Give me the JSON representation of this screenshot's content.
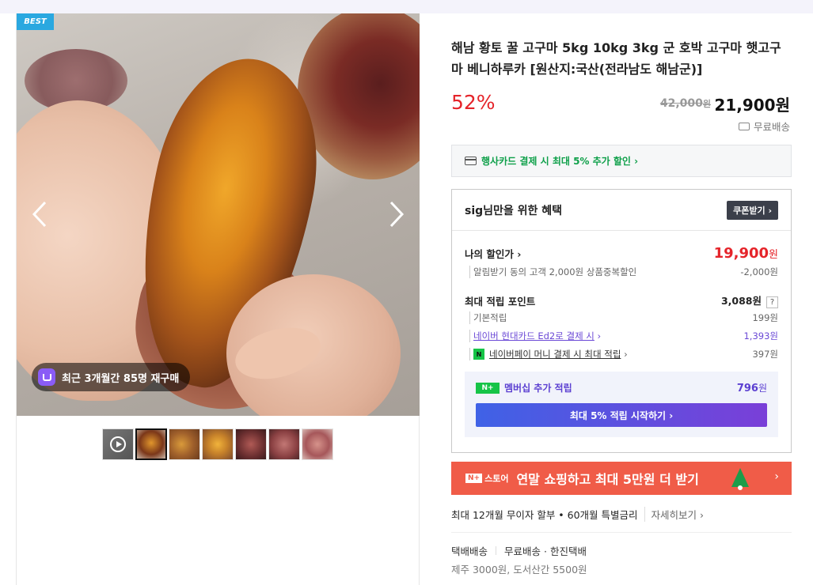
{
  "gallery": {
    "badge": "BEST",
    "repurchase_text": "최근 3개월간 85명 재구매",
    "prev_icon": "chevron-left-icon",
    "next_icon": "chevron-right-icon",
    "thumbnails": [
      "video",
      "image",
      "image",
      "image",
      "image",
      "image",
      "image"
    ],
    "active_thumbnail": 1
  },
  "product": {
    "title": "해남 황토 꿀 고구마 5kg 10kg 3kg 군 호박 고구마 햇고구마 베니하루카 [원산지:국산(전라남도 해남군)]",
    "discount": "52%",
    "original_price": "42,000",
    "original_unit": "원",
    "sale_price": "21,900원",
    "shipping": "무료배송",
    "card_banner": "행사카드 결제 시 최대 5% 추가 할인 ›"
  },
  "benefit": {
    "title": "sig님만을 위한 혜택",
    "coupon_button": "쿠폰받기 ›",
    "my_price_label": "나의 할인가 ›",
    "my_price_value": "19,900",
    "my_price_unit": "원",
    "alarm_label": "알림받기 동의 고객 2,000원 상품중복할인",
    "alarm_value": "-2,000원",
    "points_label": "최대 적립 포인트",
    "points_value": "3,088원",
    "points_help": "?",
    "basic_label": "기본적립",
    "basic_value": "199원",
    "card_label": "네이버 현대카드 Ed2로 결제 시",
    "card_arrow": "›",
    "card_value": "1,393원",
    "npay_badge": "N",
    "npay_label": "네이버페이 머니 결제 시 최대 적립",
    "npay_arrow": "›",
    "npay_value": "397원",
    "member_badge": "N+",
    "member_label": "멤버십 추가 적립",
    "member_value": "796",
    "member_unit": "원",
    "member_button": "최대 5% 적립 시작하기 ›"
  },
  "promo": {
    "logo_badge": "N+",
    "logo_text": "스토어",
    "text": "연말 쇼핑하고 최대 5만원 더 받기",
    "arrow": "›"
  },
  "installment": {
    "text": "최대 12개월 무이자 할부 • 60개월 특별금리",
    "more": "자세히보기 ›"
  },
  "delivery": {
    "type": "택배배송",
    "fee": "무료배송",
    "courier": "· 한진택배",
    "extra": "제주 3000원, 도서산간 5500원"
  },
  "colors": {
    "accent_red": "#e5242a",
    "naver_green": "#16c447",
    "membership_purple": "#5b3fd1",
    "promo_orange": "#f05c48"
  }
}
